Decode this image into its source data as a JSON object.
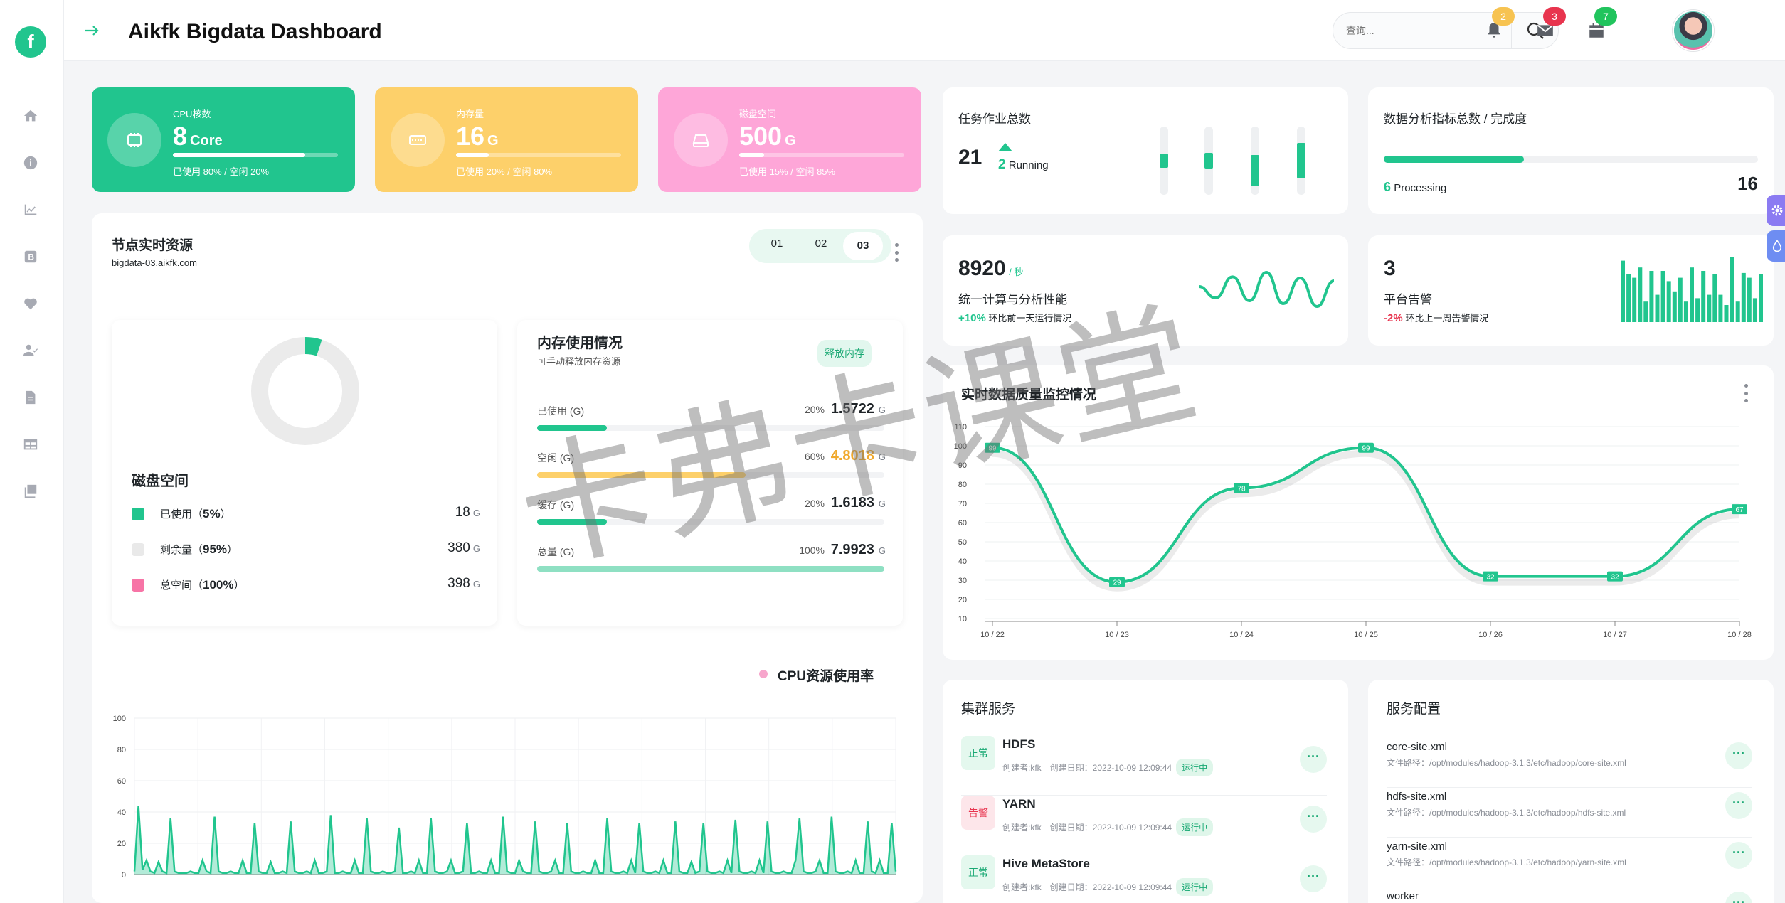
{
  "header": {
    "title": "Aikfk Bigdata Dashboard",
    "search_placeholder": "查询...",
    "notifications": [
      {
        "name": "bell",
        "count": "2",
        "color": "#f7c351"
      },
      {
        "name": "mail",
        "count": "3",
        "color": "#e8344e"
      },
      {
        "name": "calendar",
        "count": "7",
        "color": "#21c45d"
      }
    ]
  },
  "brand": {
    "logo_letter": "f",
    "accent": "#21c58e"
  },
  "sidebar": {
    "items": [
      "home-icon",
      "info-icon",
      "chart-line-icon",
      "bootstrap-icon",
      "heart-icon",
      "user-check-icon",
      "file-icon",
      "table-icon",
      "copy-icon"
    ]
  },
  "tiles": [
    {
      "label": "CPU核数",
      "value": "8",
      "unit": "Core",
      "note": "已使用 80% / 空闲 20%",
      "fill": 0.8,
      "color": "#21c58e",
      "icon": "cpu-icon"
    },
    {
      "label": "内存量",
      "value": "16",
      "unit": "G",
      "note": "已使用 20% / 空闲 80%",
      "fill": 0.2,
      "color": "#fdd06a",
      "icon": "memory-icon"
    },
    {
      "label": "磁盘空间",
      "value": "500",
      "unit": "G",
      "note": "已使用 15% / 空闲 85%",
      "fill": 0.15,
      "color": "#fea6d8",
      "icon": "harddisk-icon"
    }
  ],
  "node": {
    "title": "节点实时资源",
    "host": "bigdata-03.aikfk.com",
    "tabs": [
      "01",
      "02",
      "03"
    ],
    "active_tab": "03",
    "disk": {
      "title": "磁盘空间",
      "used_fraction": 0.05,
      "rows": [
        {
          "label": "已使用（",
          "pct": "5%",
          "close": "）",
          "value": "18",
          "unit": "G",
          "color": "#21c58e"
        },
        {
          "label": "剩余量（",
          "pct": "95%",
          "close": "）",
          "value": "380",
          "unit": "G",
          "color": "#e9e9e9"
        },
        {
          "label": "总空间（",
          "pct": "100%",
          "close": "）",
          "value": "398",
          "unit": "G",
          "color": "#f774a6"
        }
      ]
    },
    "memory": {
      "title": "内存使用情况",
      "subtitle": "可手动释放内存资源",
      "release_button": "释放内存",
      "rows": [
        {
          "label": "已使用 (G)",
          "pct": "20%",
          "value": "1.5722",
          "unit": "G",
          "fill": 0.2,
          "color": "#21c58e",
          "value_color": "#1f2428"
        },
        {
          "label": "空闲 (G)",
          "pct": "60%",
          "value": "4.8018",
          "unit": "G",
          "fill": 0.6,
          "color": "#fdd06a",
          "value_color": "#f0a92d"
        },
        {
          "label": "缓存 (G)",
          "pct": "20%",
          "value": "1.6183",
          "unit": "G",
          "fill": 0.2,
          "color": "#21c58e",
          "value_color": "#1f2428"
        },
        {
          "label": "总量 (G)",
          "pct": "100%",
          "value": "7.9923",
          "unit": "G",
          "fill": 1.0,
          "color": "#8fe0c3",
          "value_color": "#1f2428"
        }
      ]
    },
    "cpu_chart": {
      "legend": "CPU资源使用率",
      "legend_color": "#f7a6cc",
      "chart_data": {
        "type": "area",
        "ylim": [
          0,
          100
        ],
        "yticks": [
          0,
          20,
          40,
          60,
          80,
          100
        ],
        "values": [
          2,
          44,
          3,
          9,
          2,
          1,
          8,
          2,
          1,
          36,
          2,
          1,
          1,
          1,
          2,
          1,
          1,
          9,
          2,
          1,
          37,
          2,
          1,
          1,
          2,
          1,
          1,
          9,
          1,
          1,
          33,
          2,
          1,
          1,
          8,
          1,
          1,
          2,
          1,
          34,
          2,
          1,
          1,
          2,
          1,
          9,
          1,
          1,
          2,
          38,
          1,
          1,
          2,
          1,
          1,
          9,
          1,
          1,
          36,
          2,
          1,
          1,
          2,
          1,
          1,
          2,
          30,
          1,
          1,
          2,
          1,
          9,
          1,
          1,
          36,
          2,
          1,
          1,
          2,
          9,
          1,
          1,
          2,
          33,
          1,
          1,
          2,
          1,
          1,
          9,
          1,
          1,
          37,
          2,
          1,
          1,
          9,
          2,
          1,
          1,
          34,
          2,
          1,
          1,
          2,
          9,
          1,
          1,
          33,
          2,
          1,
          1,
          2,
          1,
          1,
          9,
          1,
          1,
          36,
          2,
          1,
          1,
          2,
          1,
          9,
          1,
          33,
          2,
          1,
          1,
          2,
          1,
          9,
          1,
          1,
          34,
          2,
          1,
          1,
          8,
          1,
          2,
          33,
          2,
          1,
          1,
          2,
          1,
          9,
          1,
          35,
          2,
          1,
          1,
          2,
          1,
          9,
          1,
          34,
          2,
          1,
          1,
          2,
          1,
          1,
          9,
          36,
          2,
          1,
          1,
          2,
          9,
          1,
          1,
          37,
          2,
          1,
          1,
          2,
          1,
          9,
          1,
          1,
          34,
          2,
          1,
          9,
          1,
          1,
          33,
          2
        ]
      }
    }
  },
  "jobs": {
    "title": "任务作业总数",
    "total": "21",
    "running_count": "2",
    "running_label": "Running",
    "bars": [
      0.5,
      0.4,
      0.6,
      0.65
    ]
  },
  "analytics": {
    "title": "数据分析指标总数 / 完成度",
    "processing_count": "6",
    "processing_label": "Processing",
    "total": "16",
    "progress": 0.375
  },
  "throughput": {
    "value": "8920",
    "unit": "/ 秒",
    "label": "统一计算与分析性能",
    "change": "+10%",
    "change_note": "环比前一天运行情况",
    "wave": [
      0.55,
      0.35,
      0.72,
      0.3,
      0.8,
      0.25,
      0.7,
      0.2,
      0.65
    ]
  },
  "alerts": {
    "value": "3",
    "label": "平台告警",
    "change": "-2%",
    "change_note": "环比上一周告警情况",
    "bars": [
      0.9,
      0.7,
      0.65,
      0.8,
      0.3,
      0.75,
      0.4,
      0.75,
      0.6,
      0.45,
      0.65,
      0.3,
      0.8,
      0.35,
      0.75,
      0.4,
      0.7,
      0.4,
      0.25,
      0.95,
      0.3,
      0.72,
      0.65,
      0.35,
      0.7
    ]
  },
  "quality": {
    "title": "实时数据质量监控情况",
    "chart_data": {
      "type": "line",
      "categories": [
        "10 / 22",
        "10 / 23",
        "10 / 24",
        "10 / 25",
        "10 / 26",
        "10 / 27",
        "10 / 28"
      ],
      "values": [
        99,
        29,
        78,
        99,
        32,
        32,
        67
      ],
      "ylim": [
        10,
        110
      ],
      "yticks": [
        10,
        20,
        30,
        40,
        50,
        60,
        70,
        80,
        90,
        100,
        110
      ]
    }
  },
  "cluster": {
    "title": "集群服务",
    "items": [
      {
        "status": "正常",
        "status_kind": "ok",
        "name": "HDFS",
        "creator": "创建者:kfk",
        "created": "创建日期：2022-10-09 12:09:44",
        "state": "运行中"
      },
      {
        "status": "告警",
        "status_kind": "warn",
        "name": "YARN",
        "creator": "创建者:kfk",
        "created": "创建日期：2022-10-09 12:09:44",
        "state": "运行中"
      },
      {
        "status": "正常",
        "status_kind": "ok",
        "name": "Hive MetaStore",
        "creator": "创建者:kfk",
        "created": "创建日期：2022-10-09 12:09:44",
        "state": "运行中"
      }
    ]
  },
  "config": {
    "title": "服务配置",
    "items": [
      {
        "name": "core-site.xml",
        "path": "文件路径：/opt/modules/hadoop-3.1.3/etc/hadoop/core-site.xml"
      },
      {
        "name": "hdfs-site.xml",
        "path": "文件路径：/opt/modules/hadoop-3.1.3/etc/hadoop/hdfs-site.xml"
      },
      {
        "name": "yarn-site.xml",
        "path": "文件路径：/opt/modules/hadoop-3.1.3/etc/hadoop/yarn-site.xml"
      },
      {
        "name": "worker",
        "path": ""
      }
    ],
    "more": "···"
  },
  "watermark": "卡弗卡课堂"
}
